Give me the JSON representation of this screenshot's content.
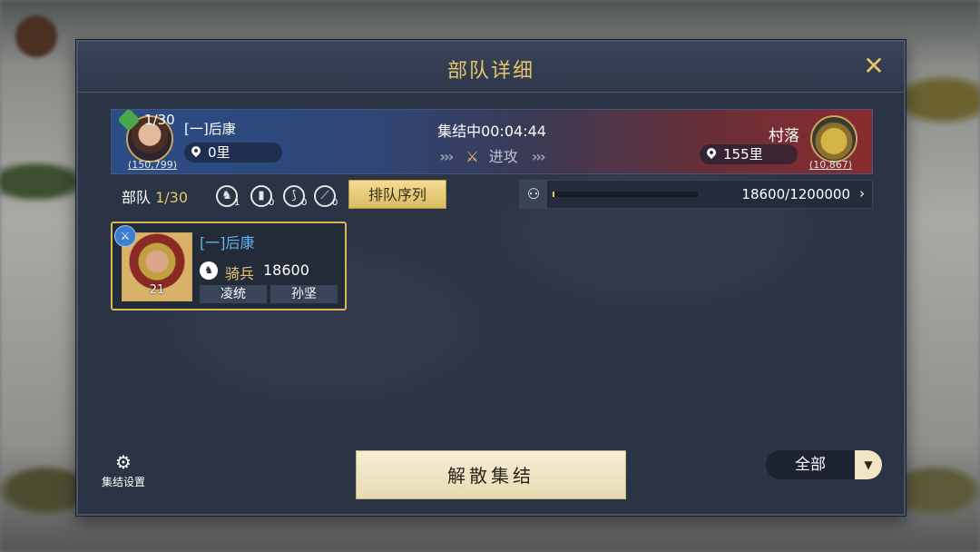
{
  "header": {
    "title": "部队详细",
    "close_icon": "close-swords-icon"
  },
  "march": {
    "left": {
      "count": "1/30",
      "name": "[一]后康",
      "power": "(150,799)",
      "distance": "0里"
    },
    "status": "集结中00:04:44",
    "action": "进攻",
    "right": {
      "name": "村落",
      "power": "(10,867)",
      "distance": "155里"
    }
  },
  "army": {
    "label": "部队",
    "count": "1/30",
    "unit_types": [
      {
        "icon": "cavalry-icon",
        "count": "1"
      },
      {
        "icon": "shield-icon",
        "count": "0"
      },
      {
        "icon": "bow-icon",
        "count": "0"
      },
      {
        "icon": "spear-icon",
        "count": "0"
      }
    ],
    "queue_button": "排队序列",
    "capacity": {
      "text": "18600/1200000",
      "fill": 0.0155
    }
  },
  "troop_card": {
    "name": "[一]后康",
    "level": "21",
    "unit_type": "骑兵",
    "unit_count": "18600",
    "generals": [
      "凌统",
      "孙坚"
    ]
  },
  "footer": {
    "settings_label": "集结设置",
    "disband_button": "解散集结",
    "filter_value": "全部"
  },
  "colors": {
    "accent_gold": "#e6c46c",
    "name_blue": "#5fb3f0",
    "panel_bg": "#2b3445"
  }
}
